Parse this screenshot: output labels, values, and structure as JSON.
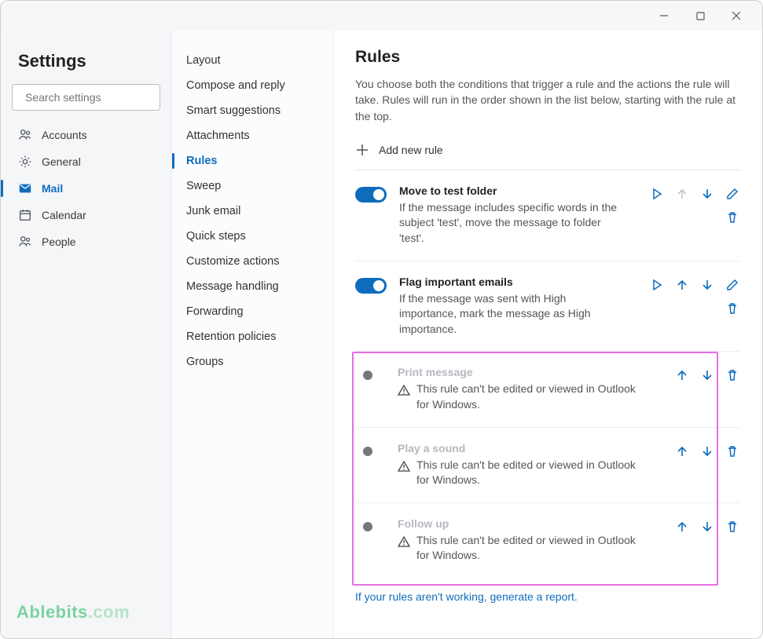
{
  "header": {
    "title": "Settings"
  },
  "search": {
    "placeholder": "Search settings"
  },
  "nav": {
    "accounts": "Accounts",
    "general": "General",
    "mail": "Mail",
    "calendar": "Calendar",
    "people": "People"
  },
  "subnav": {
    "layout": "Layout",
    "compose": "Compose and reply",
    "smart": "Smart suggestions",
    "attachments": "Attachments",
    "rules": "Rules",
    "sweep": "Sweep",
    "junk": "Junk email",
    "quick": "Quick steps",
    "customize": "Customize actions",
    "handling": "Message handling",
    "forwarding": "Forwarding",
    "retention": "Retention policies",
    "groups": "Groups"
  },
  "main": {
    "title": "Rules",
    "desc": "You choose both the conditions that trigger a rule and the actions the rule will take. Rules will run in the order shown in the list below, starting with the rule at the top.",
    "add": "Add new rule",
    "help": "If your rules aren't working, generate a report.",
    "not_editable": "This rule can't be edited or viewed in Outlook for Windows."
  },
  "rules": {
    "r1_name": "Move to test folder",
    "r1_desc": "If the message includes specific words in the subject 'test', move the message to folder 'test'.",
    "r2_name": "Flag important emails",
    "r2_desc": "If the message was sent with High importance, mark the message as High importance.",
    "r3_name": "Print message",
    "r4_name": "Play a sound",
    "r5_name": "Follow up"
  },
  "brand": {
    "pre": "Ablebits",
    "post": ".com"
  }
}
